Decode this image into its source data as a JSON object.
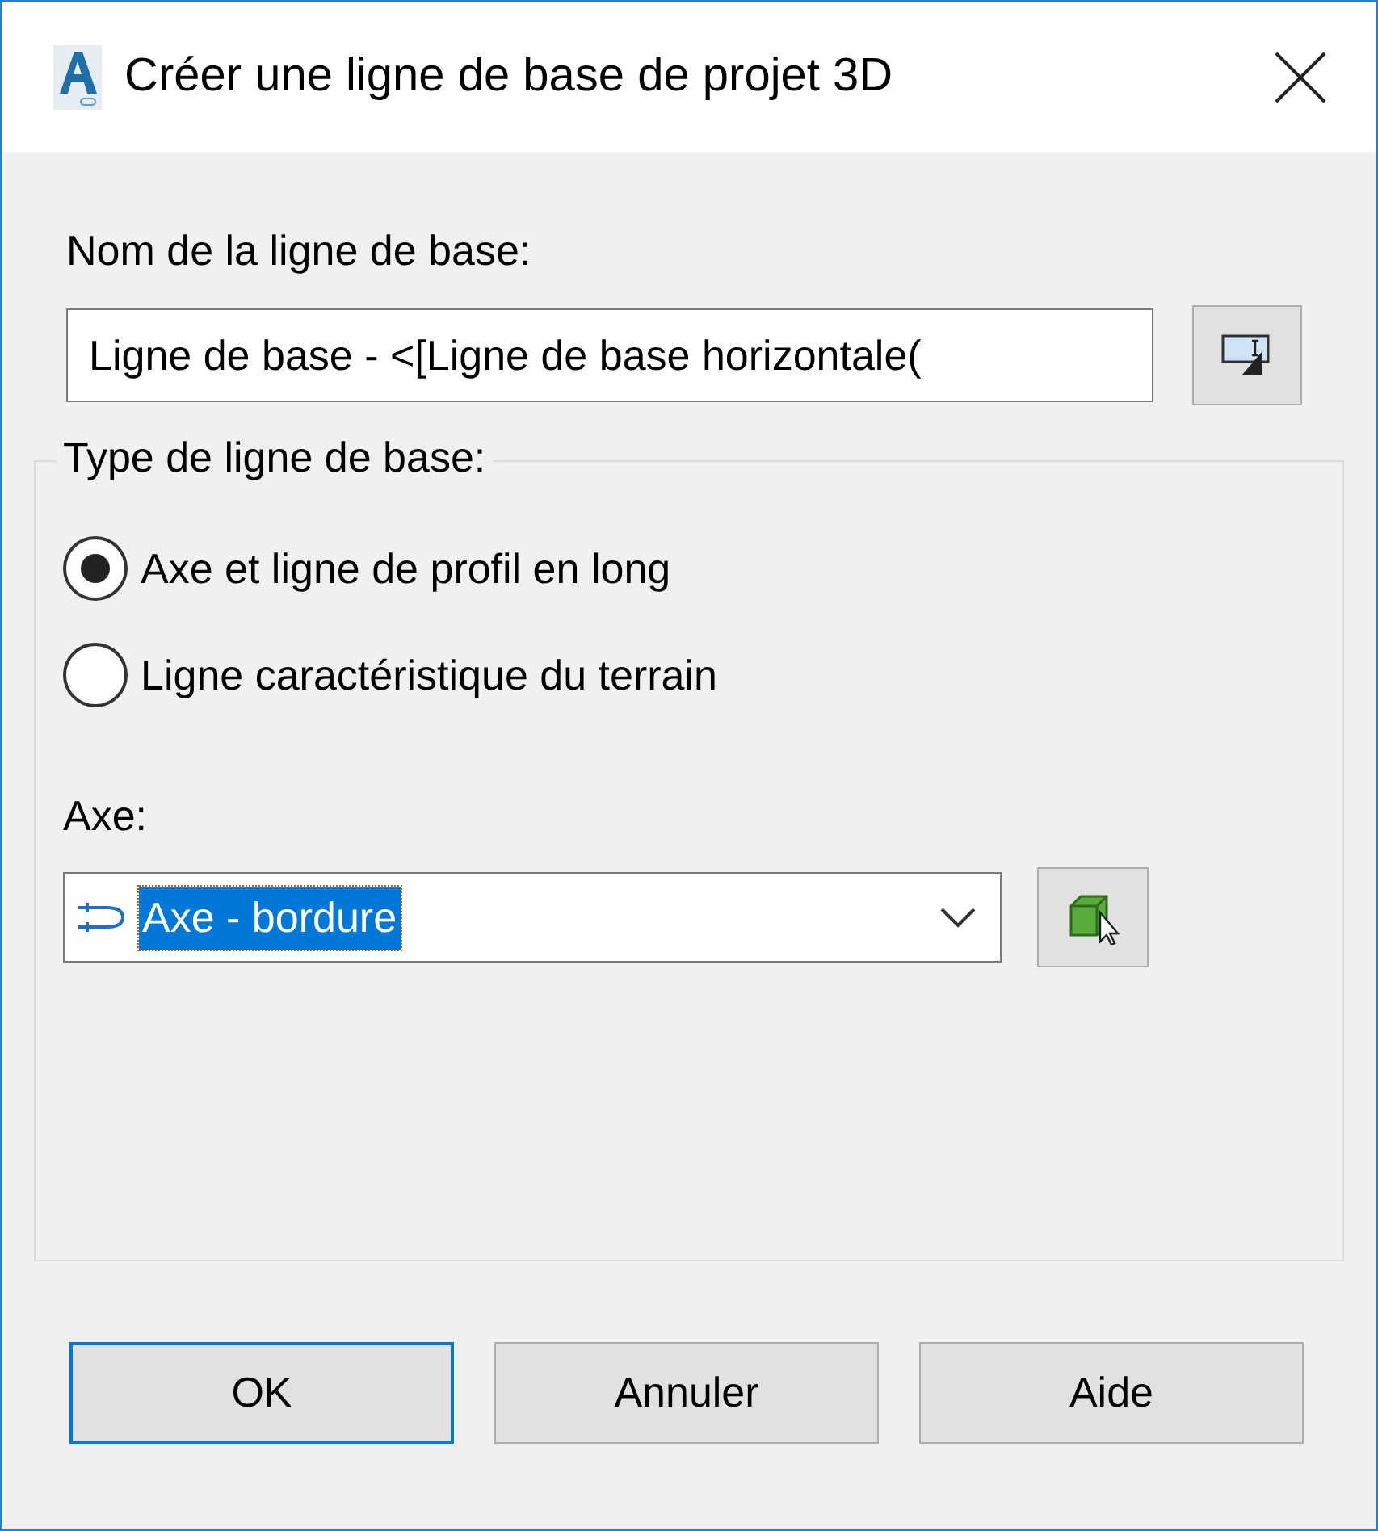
{
  "window": {
    "title": "Créer une ligne de base de projet 3D"
  },
  "name_field": {
    "label": "Nom de la ligne de base:",
    "value": "Ligne de base - <[Ligne de base horizontale("
  },
  "baseline_type": {
    "legend": "Type de ligne de base:",
    "options": [
      {
        "label": "Axe et ligne de profil en long",
        "selected": true
      },
      {
        "label": "Ligne caractéristique du terrain",
        "selected": false
      }
    ]
  },
  "alignment": {
    "label": "Axe:",
    "value": "Axe - bordure"
  },
  "buttons": [
    {
      "label": "OK",
      "default": true
    },
    {
      "label": "Annuler",
      "default": false
    },
    {
      "label": "Aide",
      "default": false
    }
  ]
}
